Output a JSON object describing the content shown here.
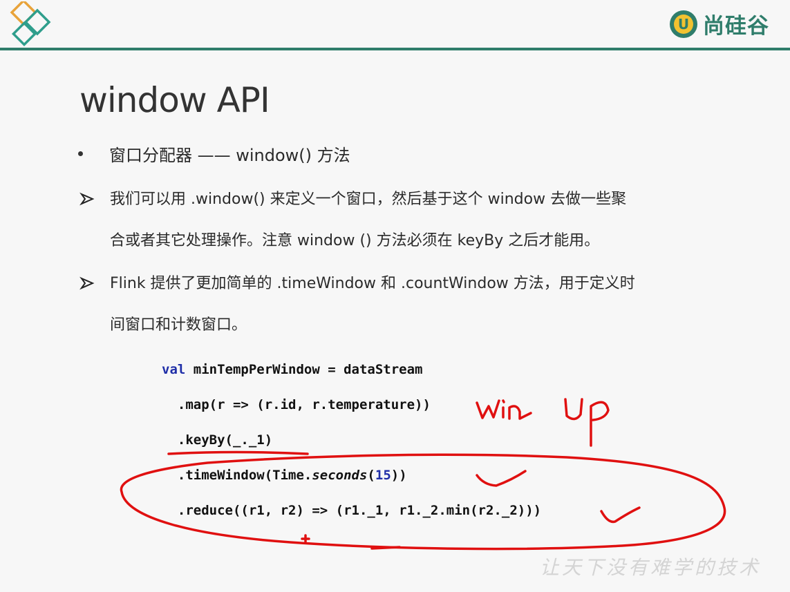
{
  "header": {
    "brand_name": "尚硅谷",
    "brand_badge_letter": "U",
    "accent_color": "#2f7d6b",
    "logo_colors": [
      "#e8a33a",
      "#2f9e8c"
    ]
  },
  "slide": {
    "title": "window API",
    "bullet": "窗口分配器 —— window() 方法",
    "items": [
      {
        "lines": [
          "我们可以用 .window() 来定义一个窗口，然后基于这个 window 去做一些聚",
          "合或者其它处理操作。注意 window () 方法必须在 keyBy 之后才能用。"
        ]
      },
      {
        "lines": [
          "Flink 提供了更加简单的 .timeWindow 和 .countWindow 方法，用于定义时",
          "间窗口和计数窗口。"
        ]
      }
    ]
  },
  "code": {
    "line1_kw": "val",
    "line1_rest": " minTempPerWindow = dataStream",
    "line2": "  .map(r => (r.id, r.temperature))",
    "line3": "  .keyBy(_._1)",
    "line4_a": "  .timeWindow(Time.",
    "line4_b": "seconds",
    "line4_c": "(",
    "line4_num": "15",
    "line4_d": "))",
    "line5": "  .reduce((r1, r2) => (r1._1, r1._2.min(r2._2)))"
  },
  "annotations": {
    "handwriting_1": "win",
    "handwriting_2": "up",
    "ink_color": "#e01010"
  },
  "watermark": "让天下没有难学的技术"
}
